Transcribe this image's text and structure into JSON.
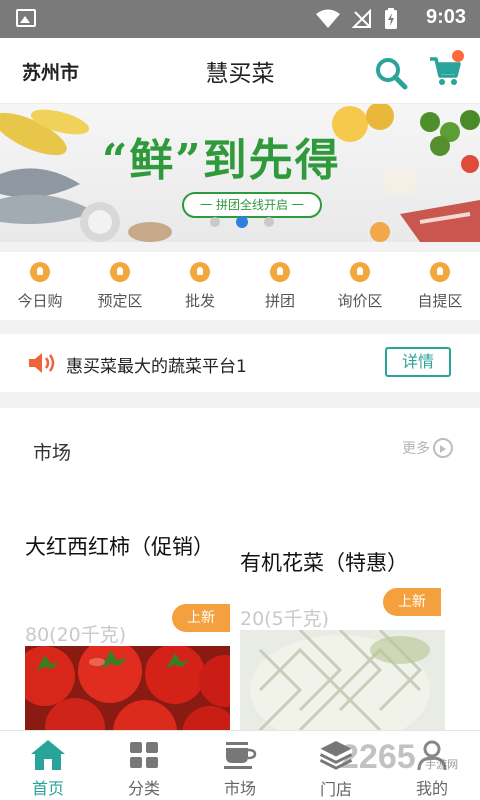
{
  "status_bar": {
    "time": "9:03"
  },
  "header": {
    "city": "苏州市",
    "title": "慧买菜"
  },
  "banner": {
    "slogan": "“鲜”到先得",
    "subtitle": "一 拼团全线开启 一",
    "active_slide": 2,
    "slide_count": 3
  },
  "categories": [
    {
      "label": "今日购"
    },
    {
      "label": "预定区"
    },
    {
      "label": "批发"
    },
    {
      "label": "拼团"
    },
    {
      "label": "询价区"
    },
    {
      "label": "自提区"
    }
  ],
  "notice": {
    "text": "惠买菜最大的蔬菜平台1",
    "detail_label": "详情"
  },
  "market": {
    "title": "市场",
    "more_label": "更多",
    "products": [
      {
        "name": "大红西红柿（促销）",
        "price": "80(20千克)",
        "tag": "上新"
      },
      {
        "name": "有机花菜（特惠）",
        "price": "20(5千克)",
        "tag": "上新"
      }
    ]
  },
  "tabs": [
    {
      "label": "首页",
      "icon": "home-icon",
      "active": true
    },
    {
      "label": "分类",
      "icon": "grid-icon",
      "active": false
    },
    {
      "label": "市场",
      "icon": "cup-icon",
      "active": false
    },
    {
      "label": "门店",
      "icon": "layers-icon",
      "active": false
    },
    {
      "label": "我的",
      "icon": "user-icon",
      "active": false
    }
  ],
  "watermark": {
    "brand": "2265",
    "sub": "手游网"
  },
  "colors": {
    "accent": "#2aa39a",
    "tag": "#f5a03e",
    "banner_green": "#2e9a3b",
    "dot_active": "#2f7fe0"
  }
}
